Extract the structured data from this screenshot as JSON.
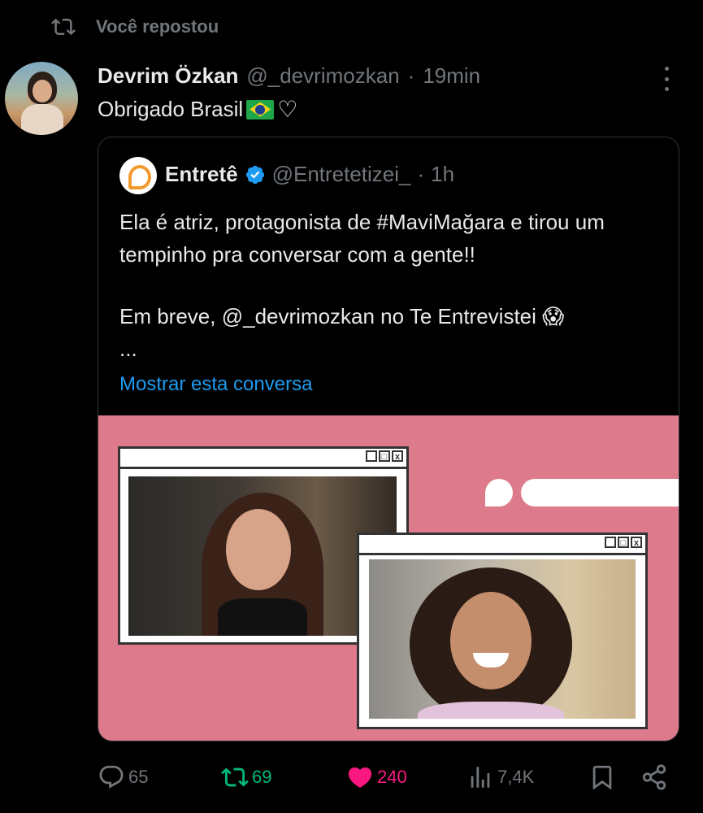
{
  "repost_header": {
    "label": "Você repostou"
  },
  "tweet": {
    "author_name": "Devrim Özkan",
    "handle": "@_devrimozkan",
    "separator": "·",
    "time": "19min",
    "text": "Obrigado Brasil",
    "emojis": [
      "flag-brazil",
      "white-heart"
    ]
  },
  "quote": {
    "author_name": "Entretê",
    "handle": "@Entretetizei_",
    "separator": "·",
    "time": "1h",
    "text_line1": "Ela é atriz, protagonista de #MaviMağara e tirou um tempinho pra conversar com a gente!!",
    "text_line2": "Em breve, @_devrimozkan no Te Entrevistei 😱",
    "ellipsis": "...",
    "show_more": "Mostrar esta conversa",
    "colors": {
      "link": "#1d9bf0",
      "media_bg": "#dd7a8b",
      "verified": "#1d9bf0"
    }
  },
  "actions": {
    "replies": "65",
    "reposts": "69",
    "likes": "240",
    "views": "7,4K",
    "colors": {
      "repost_active": "#00ba7c",
      "like_active": "#f91880",
      "muted": "#71767b"
    }
  }
}
